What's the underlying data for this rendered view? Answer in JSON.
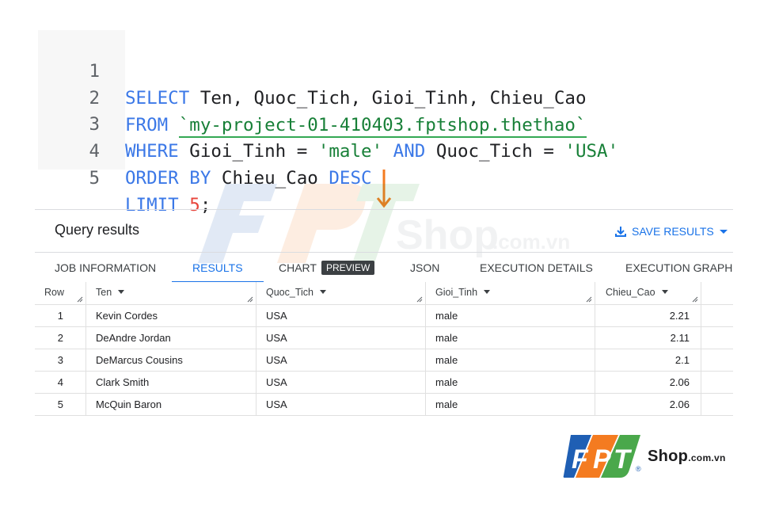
{
  "editor": {
    "lines": [
      {
        "num": "1"
      },
      {
        "num": "2"
      },
      {
        "num": "3"
      },
      {
        "num": "4"
      },
      {
        "num": "5"
      }
    ],
    "tokens": {
      "select": "SELECT",
      "select_cols": " Ten, Quoc_Tich, Gioi_Tinh, Chieu_Cao",
      "from": "FROM",
      "table": "`my-project-01-410403.fptshop.thethao`",
      "where": "WHERE",
      "where_col1": " Gioi_Tinh = ",
      "where_val1": "'male'",
      "and": "AND",
      "where_col2": " Quoc_Tich = ",
      "where_val2": "'USA'",
      "order_by": "ORDER BY",
      "order_col": " Chieu_Cao ",
      "desc": "DESC",
      "limit": "LIMIT",
      "limit_val": "5",
      "semicolon": ";"
    }
  },
  "results": {
    "title": "Query results",
    "save_label": "SAVE RESULTS",
    "tabs": [
      {
        "label": "JOB INFORMATION"
      },
      {
        "label": "RESULTS"
      },
      {
        "label": "CHART"
      },
      {
        "label": "JSON"
      },
      {
        "label": "EXECUTION DETAILS"
      },
      {
        "label": "EXECUTION GRAPH"
      }
    ],
    "chart_badge": "PREVIEW",
    "columns": [
      "Row",
      "Ten",
      "Quoc_Tich",
      "Gioi_Tinh",
      "Chieu_Cao"
    ],
    "rows": [
      [
        "1",
        "Kevin Cordes",
        "USA",
        "male",
        "2.21"
      ],
      [
        "2",
        "DeAndre Jordan",
        "USA",
        "male",
        "2.11"
      ],
      [
        "3",
        "DeMarcus Cousins",
        "USA",
        "male",
        "2.1"
      ],
      [
        "4",
        "Clark Smith",
        "USA",
        "male",
        "2.06"
      ],
      [
        "5",
        "McQuin Baron",
        "USA",
        "male",
        "2.06"
      ]
    ]
  },
  "watermark": {
    "text": "Shop",
    "suffix": ".com.vn"
  },
  "logo": {
    "letters": [
      "F",
      "P",
      "T"
    ],
    "shop": "Shop",
    "suffix": ".com.vn",
    "registered": "®"
  },
  "colors": {
    "keyword": "#3b78e7",
    "string": "#188038",
    "number": "#e8453c",
    "accent": "#1a73e8",
    "arrow": "#f47b20",
    "logo_blue": "#1f5fb4",
    "logo_orange": "#f47b20",
    "logo_green": "#4aa84b"
  }
}
